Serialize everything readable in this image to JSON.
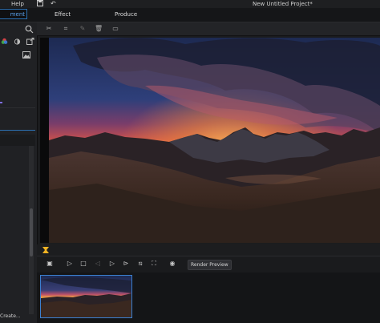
{
  "menubar": {
    "help": "Help",
    "project_title": "New Untitled Project*"
  },
  "tabs": {
    "left_partial": "ment",
    "effect": "Effect",
    "produce": "Produce"
  },
  "left_panel": {
    "create_label": "Create..."
  },
  "player": {
    "render_preview": "Render Preview"
  },
  "colors": {
    "accent": "#3b7fcf",
    "marker": "#f0b323"
  }
}
